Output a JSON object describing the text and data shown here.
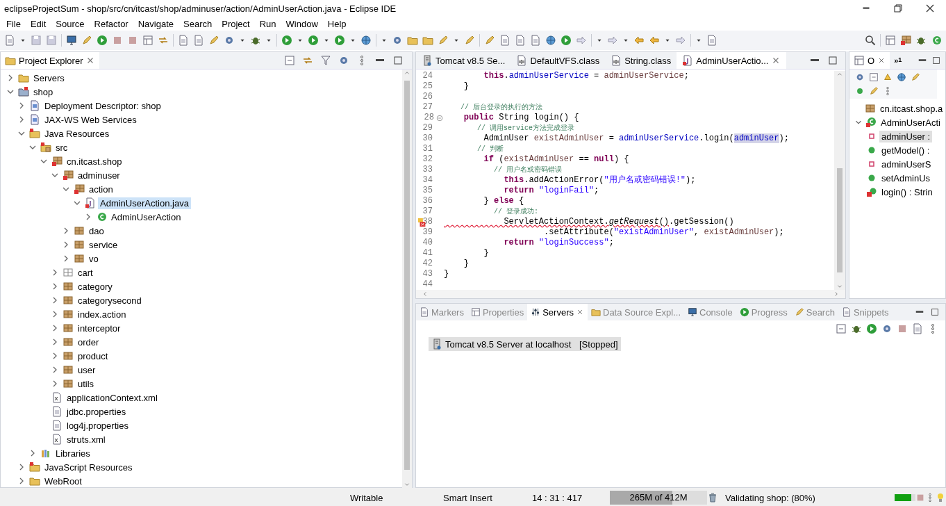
{
  "window": {
    "title": "eclipseProjectSum - shop/src/cn/itcast/shop/adminuser/action/AdminUserAction.java - Eclipse IDE"
  },
  "menu": [
    "File",
    "Edit",
    "Source",
    "Refactor",
    "Navigate",
    "Search",
    "Project",
    "Run",
    "Window",
    "Help"
  ],
  "project_explorer": {
    "title": "Project Explorer",
    "tree": [
      {
        "label": "Servers",
        "kind": "folder",
        "expanded": false
      },
      {
        "label": "shop",
        "kind": "project",
        "expanded": true,
        "children": [
          {
            "label": "Deployment Descriptor: shop",
            "kind": "descriptor",
            "expanded": false
          },
          {
            "label": "JAX-WS Web Services",
            "kind": "descriptor",
            "expanded": false
          },
          {
            "label": "Java Resources",
            "kind": "java-resources",
            "expanded": true,
            "children": [
              {
                "label": "src",
                "kind": "src",
                "expanded": true,
                "children": [
                  {
                    "label": "cn.itcast.shop",
                    "kind": "package-error",
                    "expanded": true,
                    "children": [
                      {
                        "label": "adminuser",
                        "kind": "package-error",
                        "expanded": true,
                        "children": [
                          {
                            "label": "action",
                            "kind": "package-error",
                            "expanded": true,
                            "children": [
                              {
                                "label": "AdminUserAction.java",
                                "kind": "java-file",
                                "expanded": true,
                                "selected": true,
                                "children": [
                                  {
                                    "label": "AdminUserAction",
                                    "kind": "class",
                                    "expanded": false,
                                    "selected": false
                                  }
                                ]
                              }
                            ]
                          },
                          {
                            "label": "dao",
                            "kind": "package",
                            "expanded": false
                          },
                          {
                            "label": "service",
                            "kind": "package",
                            "expanded": false
                          },
                          {
                            "label": "vo",
                            "kind": "package",
                            "expanded": false
                          }
                        ]
                      },
                      {
                        "label": "cart",
                        "kind": "package-empty",
                        "expanded": false
                      },
                      {
                        "label": "category",
                        "kind": "package",
                        "expanded": false
                      },
                      {
                        "label": "categorysecond",
                        "kind": "package",
                        "expanded": false
                      },
                      {
                        "label": "index.action",
                        "kind": "package",
                        "expanded": false
                      },
                      {
                        "label": "interceptor",
                        "kind": "package",
                        "expanded": false
                      },
                      {
                        "label": "order",
                        "kind": "package",
                        "expanded": false
                      },
                      {
                        "label": "product",
                        "kind": "package",
                        "expanded": false
                      },
                      {
                        "label": "user",
                        "kind": "package",
                        "expanded": false
                      },
                      {
                        "label": "utils",
                        "kind": "package",
                        "expanded": false
                      }
                    ]
                  },
                  {
                    "label": "applicationContext.xml",
                    "kind": "xml"
                  },
                  {
                    "label": "jdbc.properties",
                    "kind": "file"
                  },
                  {
                    "label": "log4j.properties",
                    "kind": "file"
                  },
                  {
                    "label": "struts.xml",
                    "kind": "xml"
                  }
                ]
              },
              {
                "label": "Libraries",
                "kind": "libraries",
                "expanded": false
              }
            ]
          },
          {
            "label": "JavaScript Resources",
            "kind": "js-resources",
            "expanded": false
          },
          {
            "label": "WebRoot",
            "kind": "folder",
            "expanded": false
          }
        ]
      }
    ]
  },
  "editor": {
    "tabs": [
      {
        "label": "Tomcat v8.5 Se...",
        "kind": "server",
        "selected": false
      },
      {
        "label": "DefaultVFS.class",
        "kind": "class-file",
        "selected": false
      },
      {
        "label": "String.class",
        "kind": "class-file",
        "selected": false
      },
      {
        "label": "AdminUserActio...",
        "kind": "java",
        "selected": true
      }
    ],
    "lines": [
      {
        "number": "24",
        "tokens": [
          {
            "t": "        this",
            "kind": "keyword"
          },
          {
            "t": ".",
            "kind": "plain"
          },
          {
            "t": "adminUserService",
            "kind": "field"
          },
          {
            "t": " = ",
            "kind": "plain"
          },
          {
            "t": "adminUserService",
            "kind": "variable"
          },
          {
            "t": ";",
            "kind": "plain"
          }
        ]
      },
      {
        "number": "25",
        "tokens": [
          {
            "t": "    }",
            "kind": "plain"
          }
        ]
      },
      {
        "number": "26"
      },
      {
        "number": "27",
        "tokens": [
          {
            "t": "    // 后台登录的执行的方法",
            "kind": "comment"
          }
        ]
      },
      {
        "number": "28",
        "fold": true,
        "tokens": [
          {
            "t": "    public",
            "kind": "keyword"
          },
          {
            "t": " String login() {",
            "kind": "plain"
          }
        ]
      },
      {
        "number": "29",
        "tokens": [
          {
            "t": "        // 调用service方法完成登录",
            "kind": "comment"
          }
        ]
      },
      {
        "number": "30",
        "tokens": [
          {
            "t": "        AdminUser ",
            "kind": "plain"
          },
          {
            "t": "existAdminUser",
            "kind": "variable"
          },
          {
            "t": " = ",
            "kind": "plain"
          },
          {
            "t": "adminUserService",
            "kind": "field"
          },
          {
            "t": ".login(",
            "kind": "plain"
          },
          {
            "t": "adminUser",
            "kind": "field-highlight"
          },
          {
            "t": ");",
            "kind": "plain"
          }
        ]
      },
      {
        "number": "31",
        "tokens": [
          {
            "t": "        // 判断",
            "kind": "comment"
          }
        ]
      },
      {
        "number": "32",
        "tokens": [
          {
            "t": "        if",
            "kind": "keyword"
          },
          {
            "t": " (",
            "kind": "plain"
          },
          {
            "t": "existAdminUser",
            "kind": "variable"
          },
          {
            "t": " == ",
            "kind": "plain"
          },
          {
            "t": "null",
            "kind": "keyword"
          },
          {
            "t": ") {",
            "kind": "plain"
          }
        ]
      },
      {
        "number": "33",
        "tokens": [
          {
            "t": "            // 用户名或密码错误",
            "kind": "comment"
          }
        ]
      },
      {
        "number": "34",
        "tokens": [
          {
            "t": "            this",
            "kind": "keyword"
          },
          {
            "t": ".addActionError(",
            "kind": "plain"
          },
          {
            "t": "\"用户名或密码错误!\"",
            "kind": "string"
          },
          {
            "t": ");",
            "kind": "plain"
          }
        ]
      },
      {
        "number": "35",
        "tokens": [
          {
            "t": "            return ",
            "kind": "keyword"
          },
          {
            "t": "\"loginFail\"",
            "kind": "string"
          },
          {
            "t": ";",
            "kind": "plain"
          }
        ]
      },
      {
        "number": "36",
        "tokens": [
          {
            "t": "        } ",
            "kind": "plain"
          },
          {
            "t": "else",
            "kind": "keyword"
          },
          {
            "t": " {",
            "kind": "plain"
          }
        ]
      },
      {
        "number": "37",
        "tokens": [
          {
            "t": "            // 登录成功:",
            "kind": "comment"
          }
        ]
      },
      {
        "number": "38",
        "error": true,
        "tokens": [
          {
            "t": "            ServletActionContext.",
            "kind": "error"
          },
          {
            "t": "getRequest",
            "kind": "italic-error"
          },
          {
            "t": "()",
            "kind": "error"
          },
          {
            "t": ".getSession()",
            "kind": "plain"
          }
        ]
      },
      {
        "number": "39",
        "tokens": [
          {
            "t": "                    .setAttribute(",
            "kind": "plain"
          },
          {
            "t": "\"existAdminUser\"",
            "kind": "string"
          },
          {
            "t": ", ",
            "kind": "plain"
          },
          {
            "t": "existAdminUser",
            "kind": "variable"
          },
          {
            "t": ");",
            "kind": "plain"
          }
        ]
      },
      {
        "number": "40",
        "tokens": [
          {
            "t": "            return ",
            "kind": "keyword"
          },
          {
            "t": "\"loginSuccess\"",
            "kind": "string"
          },
          {
            "t": ";",
            "kind": "plain"
          }
        ]
      },
      {
        "number": "41",
        "tokens": [
          {
            "t": "        }",
            "kind": "plain"
          }
        ]
      },
      {
        "number": "42",
        "tokens": [
          {
            "t": "    }",
            "kind": "plain"
          }
        ]
      },
      {
        "number": "43",
        "tokens": [
          {
            "t": "}",
            "kind": "plain"
          }
        ]
      },
      {
        "number": "44"
      }
    ]
  },
  "outline": {
    "tab": "O",
    "more": "»",
    "more_count": "1",
    "items": [
      {
        "label": "cn.itcast.shop.a",
        "kind": "package",
        "selected": false
      },
      {
        "label": "AdminUserActi",
        "kind": "class-error",
        "selected": false,
        "expanded": true
      },
      {
        "label": "adminUser :",
        "kind": "private-field",
        "selected": true
      },
      {
        "label": "getModel() :",
        "kind": "public-method",
        "selected": false
      },
      {
        "label": "adminUserS",
        "kind": "private-field",
        "selected": false
      },
      {
        "label": "setAdminUs",
        "kind": "public-method",
        "selected": false
      },
      {
        "label": "login() : Strin",
        "kind": "method-error",
        "selected": false
      }
    ]
  },
  "bottom_panel": {
    "tabs": [
      {
        "label": "Markers",
        "selected": false
      },
      {
        "label": "Properties",
        "selected": false
      },
      {
        "label": "Servers",
        "selected": true
      },
      {
        "label": "Data Source Expl...",
        "selected": false
      },
      {
        "label": "Console",
        "selected": false
      },
      {
        "label": "Progress",
        "selected": false
      },
      {
        "label": "Search",
        "selected": false
      },
      {
        "label": "Snippets",
        "selected": false
      }
    ],
    "servers": [
      {
        "name": "Tomcat v8.5 Server at localhost",
        "state": "[Stopped]",
        "selected": true
      }
    ]
  },
  "status_bar": {
    "mode": "Writable",
    "insert": "Smart Insert",
    "position": "14 : 31 : 417",
    "heap": {
      "text": "265M of 412M",
      "level": 0.64
    },
    "task": {
      "text": "Validating shop: (80%)",
      "level": 0.8
    }
  }
}
